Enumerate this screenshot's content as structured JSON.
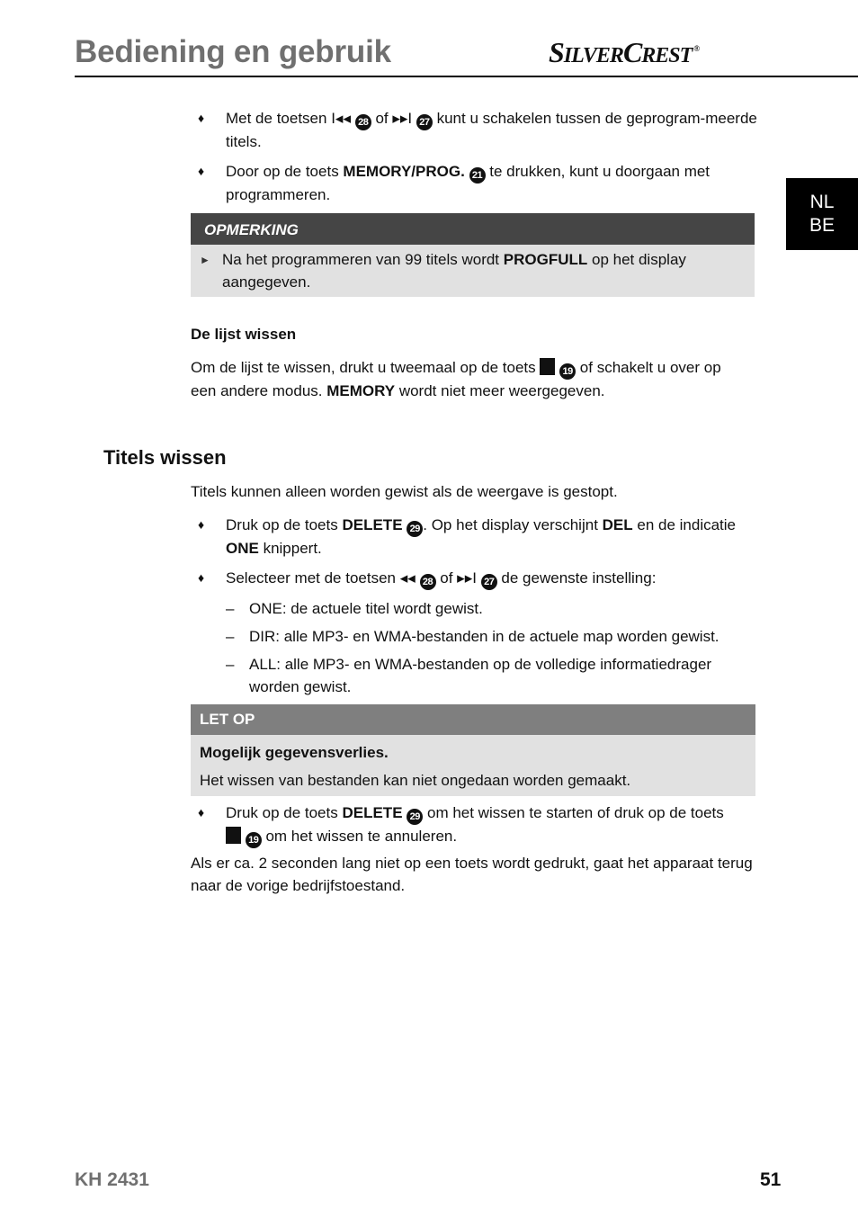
{
  "header": {
    "title": "Bediening en gebruik",
    "brand_part1_cap": "S",
    "brand_part1_rest": "ILVER",
    "brand_part2_cap": "C",
    "brand_part2_rest": "REST",
    "brand_registered": "®"
  },
  "language_tab": {
    "line1": "NL",
    "line2": "BE"
  },
  "programming": {
    "bullets": [
      {
        "t1": "Met de toetsen ",
        "icon1": "I◂◂",
        "num1": "28",
        "t2": " of ",
        "icon2": "▸▸I",
        "num2": "27",
        "t3": " kunt u schakelen tussen de geprogram-meerde titels."
      },
      {
        "t1": "Door op de toets ",
        "bold1": "MEMORY/PROG.",
        "num1": "21",
        "t2": " te drukken, kunt u doorgaan met programmeren."
      }
    ],
    "note": {
      "heading": "OPMERKING",
      "t1": "Na het programmeren van 99 titels wordt ",
      "bold1": "PROGFULL",
      "t2": " op het display aangegeven."
    }
  },
  "clear_list": {
    "heading": "De lijst wissen",
    "t1": "Om de lijst te wissen, drukt u tweemaal op de toets ",
    "num1": "19",
    "t2": " of schakelt u over op een andere modus. ",
    "bold1": "MEMORY",
    "t3": " wordt niet meer weergegeven."
  },
  "delete_titles": {
    "heading": "Titels wissen",
    "intro": "Titels kunnen alleen worden gewist als de weergave is gestopt.",
    "bullet1": {
      "t1": "Druk op de toets ",
      "bold1": "DELETE",
      "num1": "29",
      "t2": ". Op het display verschijnt ",
      "bold2": "DEL",
      "t3": " en de indicatie ",
      "bold3": "ONE",
      "t4": " knippert."
    },
    "bullet2": {
      "t1": "Selecteer met de toetsen ",
      "icon1": "◂◂",
      "num1": "28",
      "t2": " of ",
      "icon2": "▸▸I",
      "num2": "27",
      "t3": " de gewenste instelling:"
    },
    "options": [
      "ONE: de actuele titel wordt gewist.",
      "DIR: alle MP3- en WMA-bestanden in de actuele map worden gewist.",
      "ALL: alle MP3- en WMA-bestanden op de volledige informatiedrager worden gewist."
    ],
    "warning": {
      "heading": "LET OP",
      "title": "Mogelijk gegevensverlies.",
      "text": "Het wissen van bestanden kan niet ongedaan worden gemaakt."
    },
    "bullet3": {
      "t1": "Druk op de toets ",
      "bold1": "DELETE",
      "num1": "29",
      "t2": " om het wissen te starten of druk op de toets ",
      "num2": "19",
      "t3": " om het wissen te annuleren."
    },
    "closing": "Als er ca. 2 seconden lang niet op een toets wordt gedrukt, gaat het apparaat terug naar de vorige bedrijfstoestand."
  },
  "footer": {
    "model": "KH 2431",
    "page_number": "51"
  }
}
